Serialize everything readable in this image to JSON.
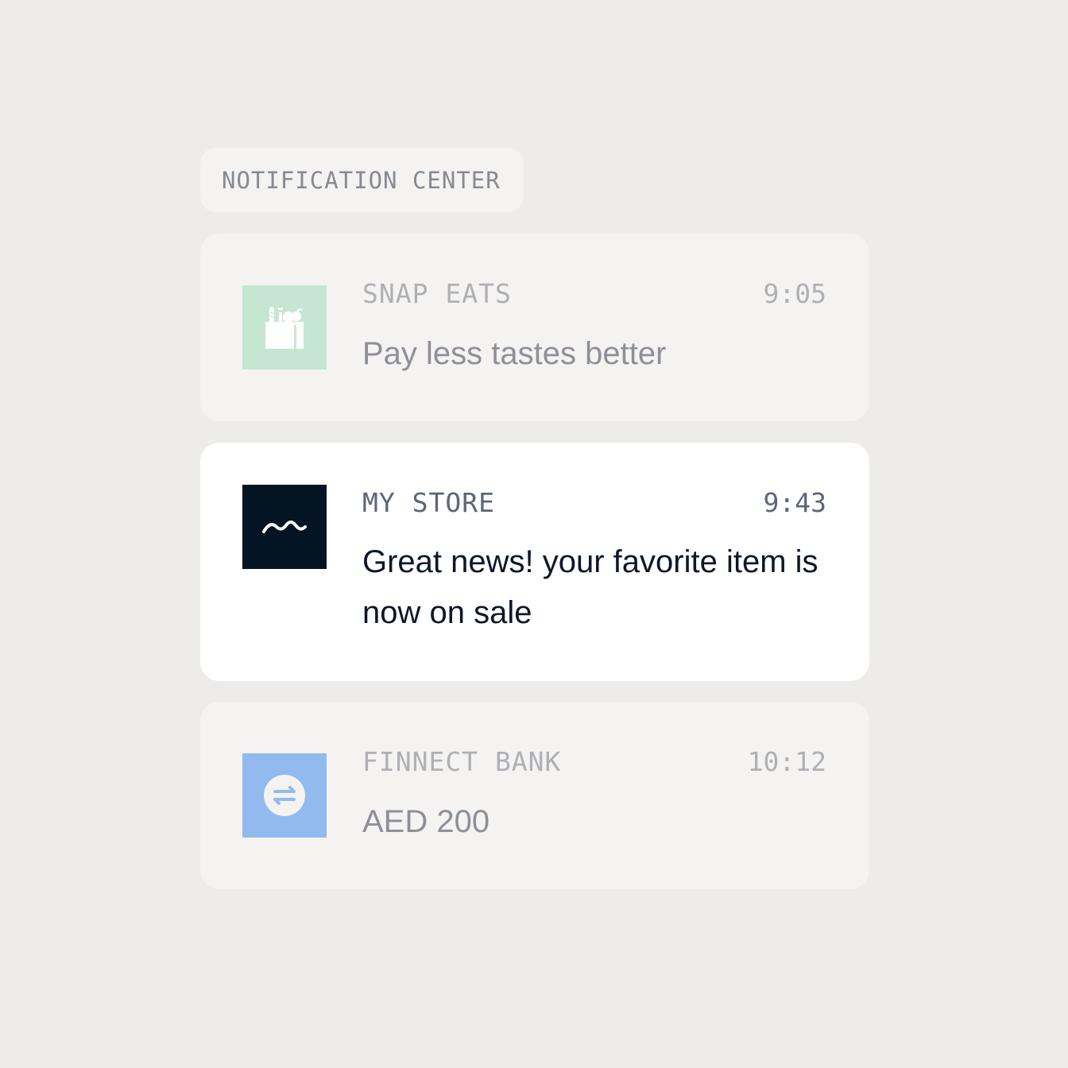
{
  "header": {
    "title": "NOTIFICATION CENTER"
  },
  "notifications": [
    {
      "app": "SNAP EATS",
      "time": "9:05",
      "message": "Pay less tastes better",
      "icon": "grocery-bag-icon",
      "icon_bg": "#C6E6D2",
      "state": "read"
    },
    {
      "app": "MY STORE",
      "time": "9:43",
      "message": "Great news! your favorite item is now on sale",
      "icon": "wave-logo-icon",
      "icon_bg": "#041423",
      "state": "highlighted"
    },
    {
      "app": "FINNECT BANK",
      "time": "10:12",
      "message": "AED 200",
      "icon": "transfer-arrows-icon",
      "icon_bg": "#93BAEE",
      "state": "read"
    }
  ],
  "colors": {
    "background": "#EDECEA",
    "card_muted": "#F4F3F1",
    "card_active": "#FFFFFF",
    "text_active": "#0E1728",
    "text_muted": "#8D9097"
  }
}
